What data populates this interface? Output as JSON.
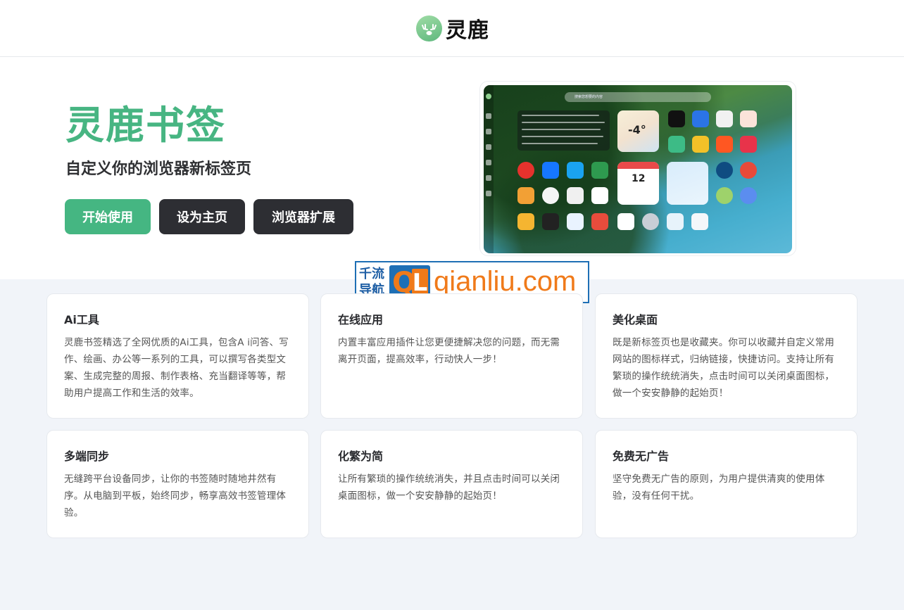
{
  "header": {
    "brand_name": "灵鹿"
  },
  "hero": {
    "title": "灵鹿书签",
    "subtitle": "自定义你的浏览器新标签页",
    "buttons": {
      "start": "开始使用",
      "set_home": "设为主页",
      "extension": "浏览器扩展"
    }
  },
  "preview": {
    "search_placeholder": "搜索您想要的内容",
    "weather_temp": "-4°",
    "calendar_day": "12"
  },
  "watermark": {
    "cn_line1": "千流",
    "cn_line2": "导航",
    "q": "Q",
    "l": "L",
    "domain": "qianliu.com"
  },
  "features": [
    {
      "title": "Ai工具",
      "text": "灵鹿书签精选了全网优质的Ai工具，包含A i问答、写作、绘画、办公等一系列的工具，可以撰写各类型文案、生成完整的周报、制作表格、充当翻译等等，帮助用户提高工作和生活的效率。"
    },
    {
      "title": "在线应用",
      "text": "内置丰富应用插件让您更便捷解决您的问题，而无需离开页面，提高效率，行动快人一步！"
    },
    {
      "title": "美化桌面",
      "text": "既是新标签页也是收藏夹。你可以收藏并自定义常用网站的图标样式，归纳链接，快捷访问。支持让所有繁琐的操作统统消失，点击时间可以关闭桌面图标，做一个安安静静的起始页！"
    },
    {
      "title": "多端同步",
      "text": "无缝跨平台设备同步，让你的书签随时随地井然有序。从电脑到平板，始终同步，畅享高效书签管理体验。"
    },
    {
      "title": "化繁为简",
      "text": "让所有繁琐的操作统统消失，并且点击时间可以关闭桌面图标，做一个安安静静的起始页！"
    },
    {
      "title": "免费无广告",
      "text": "坚守免费无广告的原则，为用户提供清爽的使用体验，没有任何干扰。"
    }
  ],
  "colors": {
    "brand_green": "#45b682",
    "dark_button": "#2d2e33",
    "watermark_blue": "#1e6fb5",
    "watermark_orange": "#f07a1a",
    "page_bg": "#f1f4f9"
  }
}
